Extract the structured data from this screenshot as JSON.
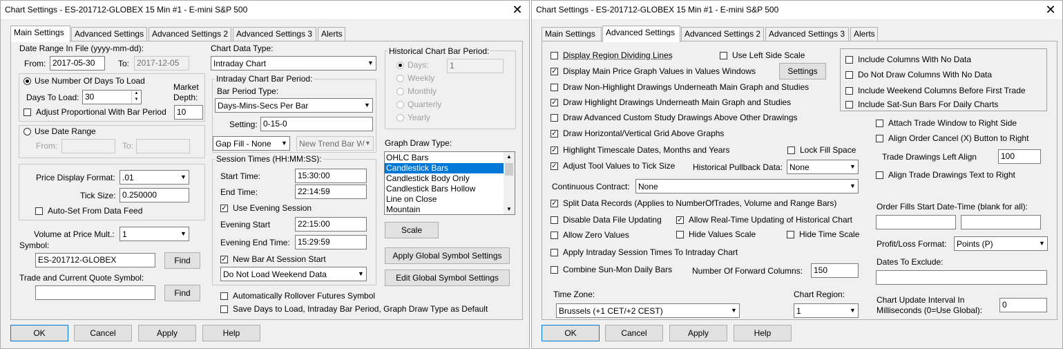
{
  "left": {
    "title": "Chart Settings - ES-201712-GLOBEX  15 Min  #1 - E-mini S&P 500",
    "tabs": [
      "Main Settings",
      "Advanced Settings",
      "Advanced Settings 2",
      "Advanced Settings 3",
      "Alerts"
    ],
    "date_range": {
      "label": "Date Range In File (yyyy-mm-dd):",
      "from_label": "From:",
      "from": "2017-05-30",
      "to_label": "To:",
      "to": "2017-12-05"
    },
    "days": {
      "radio": "Use Number Of Days To Load",
      "days_label": "Days To Load:",
      "days_value": "30",
      "market_depth_label": "Market Depth:",
      "market_depth": "10",
      "adjust_label": "Adjust Proportional With Bar Period"
    },
    "use_date_range": {
      "radio": "Use Date Range",
      "from_label": "From:",
      "to_label": "To:"
    },
    "price": {
      "format_label": "Price Display Format:",
      "format": ".01",
      "tick_label": "Tick Size:",
      "tick": "0.250000",
      "autoset": "Auto-Set From Data Feed"
    },
    "volume": {
      "label": "Volume at Price Mult.:",
      "value": "1"
    },
    "symbol": {
      "label": "Symbol:",
      "value": "ES-201712-GLOBEX",
      "find": "Find"
    },
    "trade_symbol": {
      "label": "Trade and Current Quote Symbol:",
      "value": "",
      "find": "Find"
    },
    "chart_data_type": {
      "label": "Chart Data Type:",
      "value": "Intraday Chart"
    },
    "intraday": {
      "title": "Intraday Chart Bar Period:",
      "bar_type_label": "Bar Period Type:",
      "bar_type": "Days-Mins-Secs Per Bar",
      "setting_label": "Setting:",
      "setting": "0-15-0",
      "gap": "Gap Fill - None",
      "trend": "New Trend Bar W"
    },
    "session": {
      "title": "Session Times (HH:MM:SS):",
      "start_label": "Start Time:",
      "start": "15:30:00",
      "end_label": "End Time:",
      "end": "22:14:59",
      "evening_check": "Use Evening Session",
      "evening_start_label": "Evening Start",
      "evening_start": "22:15:00",
      "evening_end_label": "Evening End Time:",
      "evening_end": "15:29:59",
      "newbar": "New Bar At Session Start",
      "weekend": "Do Not Load Weekend Data"
    },
    "auto_rollover": "Automatically Rollover Futures Symbol",
    "save_days": "Save Days to Load, Intraday Bar Period, Graph Draw Type as Default",
    "historical": {
      "title": "Historical Chart Bar Period:",
      "options": [
        "Days:",
        "Weekly",
        "Monthly",
        "Quarterly",
        "Yearly"
      ],
      "days_value": "1"
    },
    "graph_draw": {
      "label": "Graph Draw Type:",
      "items": [
        "OHLC Bars",
        "Candlestick Bars",
        "Candlestick Body Only",
        "Candlestick Bars Hollow",
        "Line on Close",
        "Mountain"
      ],
      "selected": 1
    },
    "scale_btn": "Scale",
    "apply_global": "Apply Global Symbol Settings",
    "edit_global": "Edit Global Symbol Settings",
    "footer": [
      "OK",
      "Cancel",
      "Apply",
      "Help"
    ]
  },
  "right": {
    "title": "Chart Settings - ES-201712-GLOBEX  15 Min  #1 - E-mini S&P 500",
    "tabs": [
      "Main Settings",
      "Advanced Settings",
      "Advanced Settings 2",
      "Advanced Settings 3",
      "Alerts"
    ],
    "checks": {
      "display_region": "Display Region Dividing Lines",
      "use_left": "Use Left Side Scale",
      "display_main": "Display Main Price Graph Values in Values Windows",
      "settings_btn": "Settings",
      "draw_non_highlight": "Draw Non-Highlight Drawings Underneath Main Graph and Studies",
      "draw_highlight": "Draw Highlight Drawings Underneath Main Graph and Studies",
      "draw_advanced": "Draw Advanced Custom Study Drawings Above Other Drawings",
      "draw_grid": "Draw Horizontal/Vertical Grid Above Graphs",
      "highlight_timescale": "Highlight Timescale Dates, Months and Years",
      "lock_fill": "Lock Fill Space",
      "adjust_tool": "Adjust Tool Values to Tick Size",
      "split_data": "Split Data Records (Applies to NumberOfTrades, Volume and Range Bars)",
      "disable_data": "Disable Data File Updating",
      "allow_realtime": "Allow Real-Time Updating of Historical Chart",
      "allow_zero": "Allow Zero Values",
      "hide_values": "Hide Values Scale",
      "hide_time": "Hide Time Scale",
      "apply_intraday": "Apply Intraday Session Times To Intraday Chart",
      "combine": "Combine Sun-Mon Daily Bars"
    },
    "pullback": {
      "label": "Historical Pullback Data:",
      "value": "None"
    },
    "continuous": {
      "label": "Continuous Contract:",
      "value": "None"
    },
    "forward": {
      "label": "Number Of Forward Columns:",
      "value": "150"
    },
    "timezone": {
      "label": "Time Zone:",
      "value": "Brussels (+1 CET/+2 CEST)"
    },
    "region": {
      "label": "Chart Region:",
      "value": "1"
    },
    "columns_box": [
      "Include Columns With No Data",
      "Do Not Draw Columns With No Data",
      "Include Weekend Columns Before First Trade",
      "Include Sat-Sun Bars For Daily Charts"
    ],
    "attach": "Attach Trade Window to Right Side",
    "align_cancel": "Align Order Cancel (X) Button to Right",
    "trade_left": {
      "label": "Trade Drawings Left Align",
      "value": "100"
    },
    "align_text": "Align Trade Drawings Text to Right",
    "order_fills": "Order Fills Start Date-Time (blank for all):",
    "pl": {
      "label": "Profit/Loss Format:",
      "value": "Points (P)"
    },
    "dates_exclude": "Dates To Exclude:",
    "interval": {
      "label1": "Chart Update Interval In",
      "label2": "Milliseconds (0=Use Global):",
      "value": "0"
    },
    "footer": [
      "OK",
      "Cancel",
      "Apply",
      "Help"
    ]
  }
}
